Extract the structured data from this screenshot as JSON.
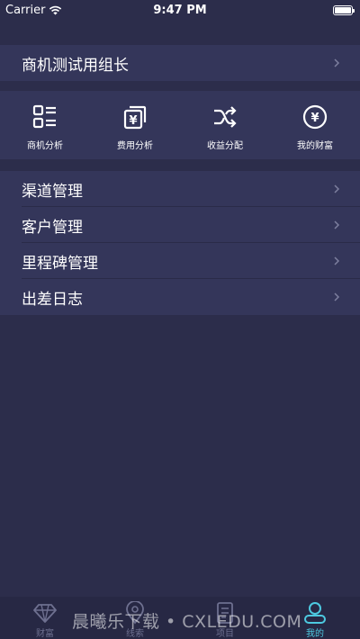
{
  "status_bar": {
    "carrier": "Carrier",
    "time": "9:47 PM"
  },
  "header_row": {
    "label": "商机测试用组长"
  },
  "quick_actions": [
    {
      "label": "商机分析",
      "icon": "list-grid-icon"
    },
    {
      "label": "费用分析",
      "icon": "yen-document-icon"
    },
    {
      "label": "收益分配",
      "icon": "shuffle-icon"
    },
    {
      "label": "我的财富",
      "icon": "yen-circle-icon"
    }
  ],
  "menu": [
    {
      "label": "渠道管理"
    },
    {
      "label": "客户管理"
    },
    {
      "label": "里程碑管理"
    },
    {
      "label": "出差日志"
    }
  ],
  "tabbar": [
    {
      "label": "财富",
      "icon": "diamond-icon",
      "active": false
    },
    {
      "label": "线索",
      "icon": "location-pin-icon",
      "active": false
    },
    {
      "label": "项目",
      "icon": "document-icon",
      "active": false
    },
    {
      "label": "我的",
      "icon": "person-icon",
      "active": true
    }
  ],
  "watermark": "晨曦乐下载 • CXLEDU.COM",
  "colors": {
    "background": "#2c2d4b",
    "row": "#34365a",
    "accent": "#4dc9e0",
    "tab_inactive": "#6e7090"
  }
}
